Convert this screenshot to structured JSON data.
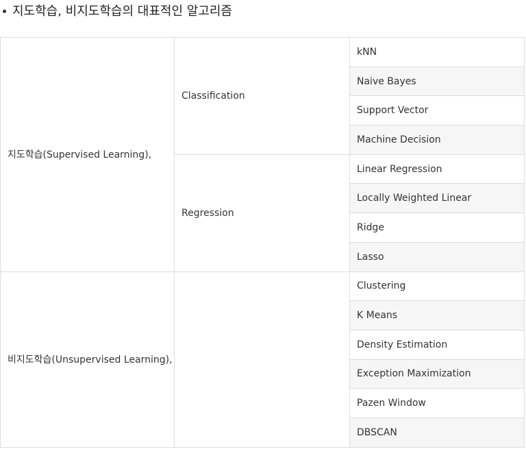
{
  "heading": "지도학습, 비지도학습의 대표적인 알고리즘",
  "table": {
    "groups": [
      {
        "label": "지도학습(Supervised Learning),",
        "subgroups": [
          {
            "label": "Classification",
            "items": [
              "kNN",
              "Naive Bayes",
              "Support Vector",
              "Machine Decision"
            ]
          },
          {
            "label": "Regression",
            "items": [
              "Linear Regression",
              "Locally Weighted Linear",
              "Ridge",
              "Lasso"
            ]
          }
        ]
      },
      {
        "label": "비지도학습(Unsupervised Learning),",
        "subgroups": [
          {
            "label": "",
            "items": [
              "Clustering",
              "K Means",
              "Density Estimation",
              "Exception Maximization",
              "Pazen Window",
              "DBSCAN"
            ]
          }
        ]
      }
    ]
  }
}
